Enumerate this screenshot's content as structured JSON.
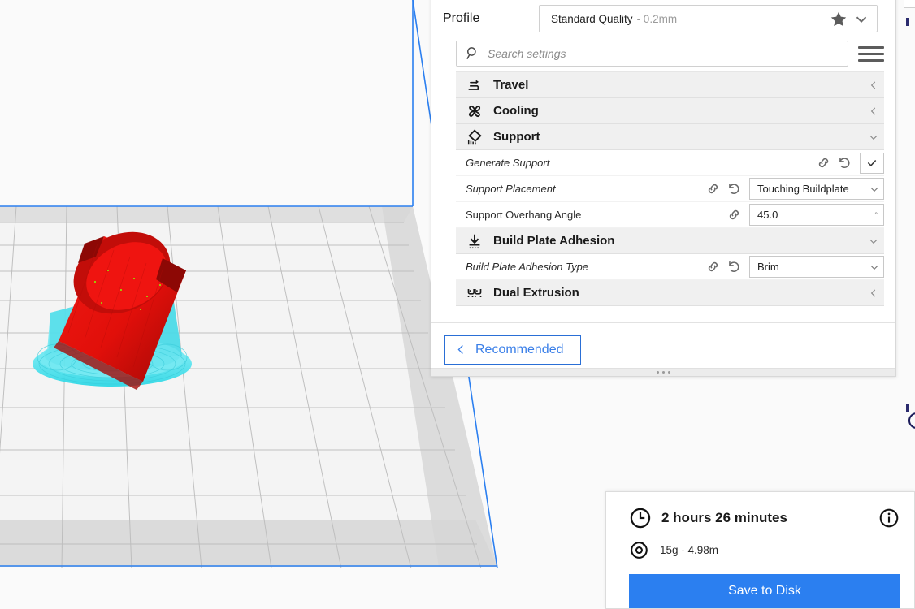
{
  "app": {
    "name": "Ultimaker Cura",
    "view": "prepare-3d-view"
  },
  "viewport": {
    "model_color": "#e8100e",
    "support_color": "#5ee6f0",
    "buildplate_color": "#f2f2f2",
    "buildplate_outline_color": "#2b7ff0",
    "grid_line_color": "#b9b9b9",
    "model_name": "tilted-cylinder",
    "support_structures": "support-and-brim"
  },
  "profile": {
    "label": "Profile",
    "name": "Standard Quality",
    "sub": "- 0.2mm",
    "favorite_icon": "star-icon",
    "expand_icon": "chevron-down-icon"
  },
  "search": {
    "placeholder": "Search settings",
    "value": "",
    "icon": "search-icon",
    "menu_icon": "hamburger-menu-icon"
  },
  "settings": {
    "categories": [
      {
        "label": "Travel",
        "icon": "travel-icon",
        "expanded": false,
        "chevron": "chevron-left-icon"
      },
      {
        "label": "Cooling",
        "icon": "cooling-fan-icon",
        "expanded": false,
        "chevron": "chevron-left-icon"
      },
      {
        "label": "Support",
        "icon": "support-icon",
        "expanded": true,
        "chevron": "chevron-down-icon"
      },
      {
        "label": "Build Plate Adhesion",
        "icon": "build-plate-adhesion-icon",
        "expanded": true,
        "chevron": "chevron-down-icon"
      },
      {
        "label": "Dual Extrusion",
        "icon": "dual-extrusion-icon",
        "expanded": false,
        "chevron": "chevron-left-icon"
      }
    ],
    "support_rows": [
      {
        "label": "Generate Support",
        "modified": true,
        "has_link": true,
        "has_revert": true,
        "control": "checkbox",
        "value": "checked"
      },
      {
        "label": "Support Placement",
        "modified": true,
        "has_link": true,
        "has_revert": true,
        "control": "combobox",
        "value": "Touching Buildplate"
      },
      {
        "label": "Support Overhang Angle",
        "modified": false,
        "has_link": true,
        "has_revert": false,
        "control": "number",
        "value": "45.0",
        "unit": "°"
      }
    ],
    "adhesion_rows": [
      {
        "label": "Build Plate Adhesion Type",
        "modified": true,
        "has_link": true,
        "has_revert": true,
        "control": "combobox",
        "value": "Brim"
      }
    ],
    "scrollbar": {
      "name": "settings-scrollbar",
      "color": "#19195c"
    }
  },
  "footer": {
    "recommended_label": "Recommended",
    "back_icon": "chevron-left-icon",
    "resize_grip": "panel-resize-grip"
  },
  "print_info": {
    "time_icon": "clock-icon",
    "time": "2 hours 26 minutes",
    "info_icon": "info-icon",
    "material_icon": "filament-spool-icon",
    "material": "15g · 4.98m",
    "save_label": "Save to Disk",
    "save_color": "#2b7ff0"
  }
}
